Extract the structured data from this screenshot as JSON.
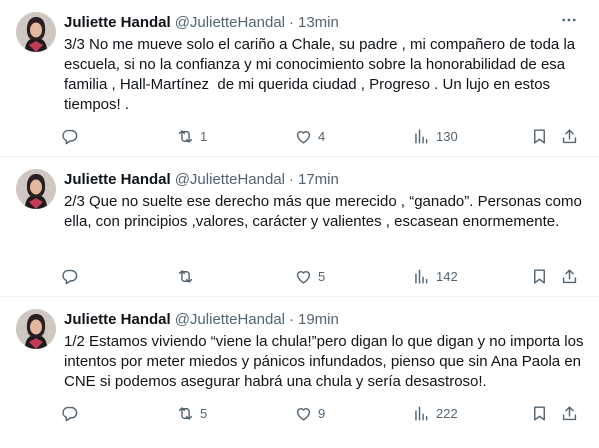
{
  "tweets": [
    {
      "name": "Juliette Handal",
      "handle": "@JulietteHandal",
      "separator": "·",
      "time": "13min",
      "text": "3/3 No me mueve solo el cariño a Chale, su padre , mi compañero de toda la escuela, si no la confianza y mi conocimiento sobre la honorabilidad de esa familia , Hall-Martínez  de mi querida ciudad , Progreso . Un lujo en estos tiempos! .",
      "reposts": "1",
      "likes": "4",
      "views": "130"
    },
    {
      "name": "Juliette Handal",
      "handle": "@JulietteHandal",
      "separator": "·",
      "time": "17min",
      "text": "2/3 Que no suelte ese derecho más que merecido , “ganado”. Personas como ella, con principios ,valores, carácter y valientes , escasean enormemente.",
      "reposts": "",
      "likes": "5",
      "views": "142"
    },
    {
      "name": "Juliette Handal",
      "handle": "@JulietteHandal",
      "separator": "·",
      "time": "19min",
      "text": "1/2 Estamos viviendo “viene la chula!”pero digan lo que digan y no importa los intentos por meter miedos y pánicos infundados, pienso que sin Ana Paola en CNE si podemos asegurar habrá una chula y sería desastroso!.",
      "reposts": "5",
      "likes": "9",
      "views": "222"
    }
  ],
  "icons": {
    "reply": "reply-icon",
    "repost": "repost-icon",
    "like": "like-icon",
    "views": "views-icon",
    "bookmark": "bookmark-icon",
    "share": "share-icon",
    "more": "more-icon"
  },
  "colors": {
    "text": "#0f1419",
    "secondary": "#536471",
    "divider": "#eff3f4"
  }
}
